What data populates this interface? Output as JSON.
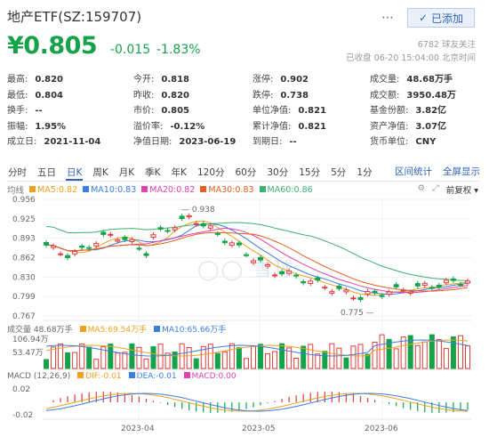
{
  "header": {
    "title": "地产ETF(SZ:159707)",
    "add_label": "已添加",
    "share_icon": "more-dots-icon"
  },
  "quote": {
    "price": "¥0.805",
    "change": "-0.015",
    "change_pct": "-1.83%",
    "followers": "6782 球友关注",
    "status": "已收盘 06-20 15:04:00 北京时间"
  },
  "stats": [
    [
      {
        "k": "最高:",
        "v": "0.820",
        "c": "up"
      },
      {
        "k": "今开:",
        "v": "0.818",
        "c": "down"
      },
      {
        "k": "涨停:",
        "v": "0.902",
        "c": "up"
      },
      {
        "k": "成交量:",
        "v": "48.68万手",
        "c": ""
      }
    ],
    [
      {
        "k": "最低:",
        "v": "0.804",
        "c": "down"
      },
      {
        "k": "昨收:",
        "v": "0.820",
        "c": ""
      },
      {
        "k": "跌停:",
        "v": "0.738",
        "c": "down"
      },
      {
        "k": "成交额:",
        "v": "3950.48万",
        "c": ""
      }
    ],
    [
      {
        "k": "换手:",
        "v": "--",
        "c": ""
      },
      {
        "k": "市价:",
        "v": "0.805",
        "c": ""
      },
      {
        "k": "单位净值:",
        "v": "0.821",
        "c": ""
      },
      {
        "k": "基金份额:",
        "v": "3.82亿",
        "c": ""
      }
    ],
    [
      {
        "k": "振幅:",
        "v": "1.95%",
        "c": ""
      },
      {
        "k": "溢价率:",
        "v": "-0.12%",
        "c": ""
      },
      {
        "k": "累计净值:",
        "v": "0.821",
        "c": ""
      },
      {
        "k": "资产净值:",
        "v": "3.07亿",
        "c": ""
      }
    ],
    [
      {
        "k": "成立日:",
        "v": "2021-11-04",
        "c": ""
      },
      {
        "k": "净值日期:",
        "v": "2023-06-19",
        "c": ""
      },
      {
        "k": "到期日:",
        "v": "--",
        "c": ""
      },
      {
        "k": "货币单位:",
        "v": "CNY",
        "c": ""
      }
    ]
  ],
  "tabs": [
    "分时",
    "五日",
    "日K",
    "周K",
    "月K",
    "季K",
    "年K",
    "120分",
    "60分",
    "30分",
    "15分",
    "5分",
    "1分"
  ],
  "active_tab": "日K",
  "tab_links": [
    "区间统计",
    "全屏显示"
  ],
  "ma_legend": {
    "label": "均线",
    "items": [
      {
        "text": "MA5:0.82",
        "color": "#f0a020"
      },
      {
        "text": "MA10:0.83",
        "color": "#3a7ee0"
      },
      {
        "text": "MA20:0.82",
        "color": "#e040b0"
      },
      {
        "text": "MA30:0.83",
        "color": "#e06020"
      },
      {
        "text": "MA60:0.86",
        "color": "#40b070"
      }
    ]
  },
  "adjust_label": "前复权",
  "volume_legend": {
    "label": "成交量 48.68万手",
    "items": [
      {
        "text": "MA5:69.54万手",
        "color": "#f0a020"
      },
      {
        "text": "MA10:65.66万手",
        "color": "#3a7ee0"
      }
    ]
  },
  "macd_legend": {
    "label": "MACD (12,26,9)",
    "items": [
      {
        "text": "DIF:-0.01",
        "color": "#f0a020"
      },
      {
        "text": "DEA:-0.01",
        "color": "#3a7ee0"
      },
      {
        "text": "MACD:0.00",
        "color": "#e040b0"
      }
    ]
  },
  "watermark": "雪球",
  "chart_data": {
    "type": "candlestick",
    "price_axis_ticks": [
      "0.956",
      "0.925",
      "0.893",
      "0.862",
      "0.830",
      "0.799",
      "0.767"
    ],
    "ylim": [
      0.767,
      0.956
    ],
    "volume_axis_ticks": [
      "106.94万",
      "53.47万"
    ],
    "macd_axis_ticks": [
      "0.02",
      "0",
      "-0.02"
    ],
    "x_tick_labels": [
      "2023-04",
      "2023-05",
      "2023-06"
    ],
    "annotations": [
      {
        "text": "0.938"
      },
      {
        "text": "0.775"
      }
    ],
    "colors": {
      "up": "#e03a3a",
      "down": "#15a34a"
    }
  }
}
